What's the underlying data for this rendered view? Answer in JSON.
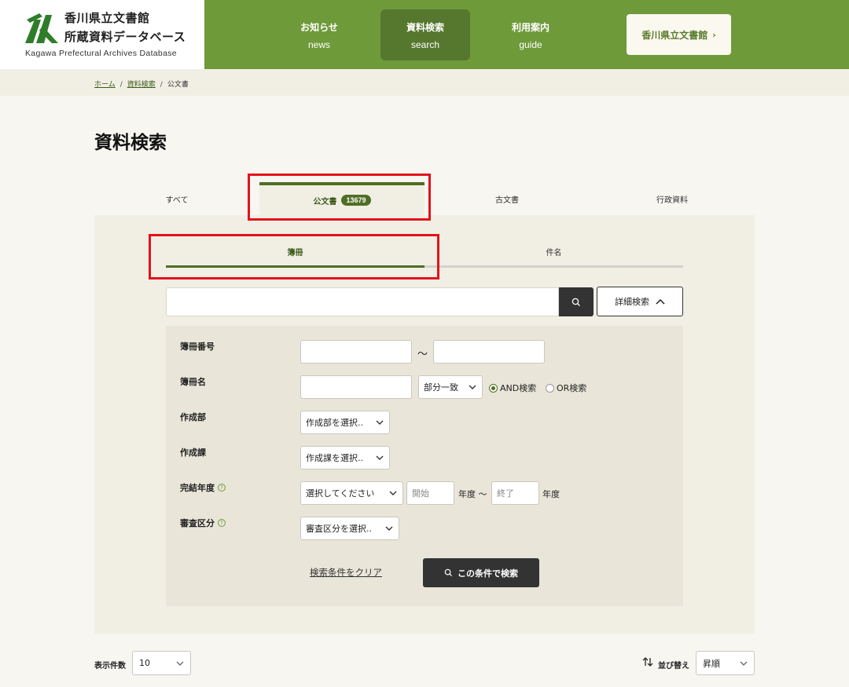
{
  "header": {
    "logo_title_line1": "香川県立文書館",
    "logo_title_line2": "所蔵資料データベース",
    "logo_en": "Kagawa Prefectural Archives Database",
    "nav": [
      {
        "jp": "お知らせ",
        "en": "news"
      },
      {
        "jp": "資料検索",
        "en": "search"
      },
      {
        "jp": "利用案内",
        "en": "guide"
      }
    ],
    "archive_button": "香川県立文書館",
    "colors": {
      "brand": "#6e9a3a",
      "active_nav": "#56772e",
      "accent_dark": "#4f6e24",
      "highlight": "#e3121b"
    }
  },
  "breadcrumb": [
    "ホーム",
    "資料検索",
    "公文書"
  ],
  "page_title": "資料検索",
  "main_tabs": [
    {
      "label": "すべて"
    },
    {
      "label": "公文書",
      "count": "13679"
    },
    {
      "label": "古文書"
    },
    {
      "label": "行政資料"
    }
  ],
  "sub_tabs": [
    "簿冊",
    "件名"
  ],
  "search": {
    "value": "",
    "detail_button": "詳細検索"
  },
  "advanced": {
    "volume_number": {
      "label": "簿冊番号",
      "separator": "～"
    },
    "volume_name": {
      "label": "簿冊名",
      "match_select": "部分一致",
      "and_label": "AND検索",
      "or_label": "OR検索"
    },
    "department": {
      "label": "作成部",
      "select": "作成部を選択.."
    },
    "section": {
      "label": "作成課",
      "select": "作成課を選択.."
    },
    "completion_year": {
      "label": "完結年度",
      "select": "選択してください",
      "start_placeholder": "開始",
      "unit1": "年度 ～",
      "end_placeholder": "終了",
      "unit2": "年度"
    },
    "review": {
      "label": "審査区分",
      "select": "審査区分を選択.."
    },
    "clear_link": "検索条件をクリア",
    "submit_button": "この条件で検索"
  },
  "results_controls": {
    "per_page_label": "表示件数",
    "per_page_value": "10",
    "sort_label": "並び替え",
    "sort_value": "昇順"
  }
}
